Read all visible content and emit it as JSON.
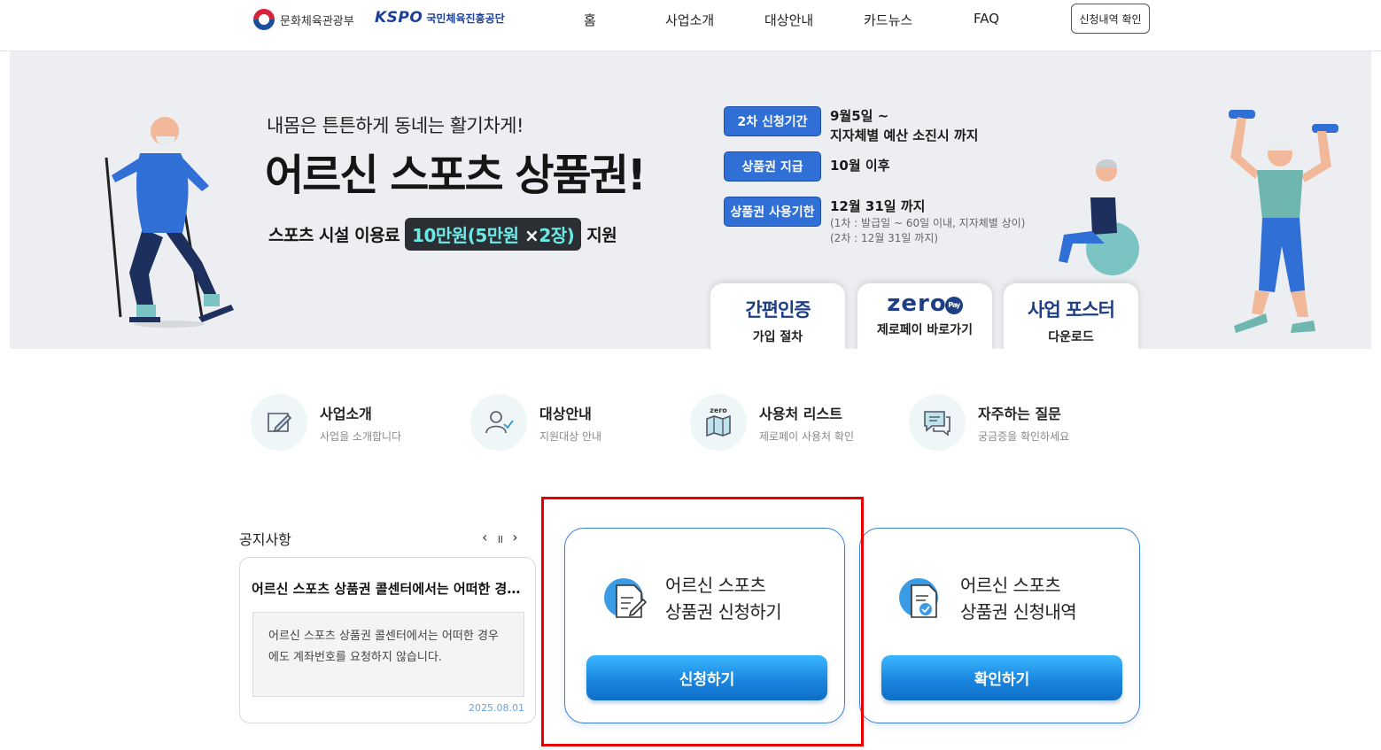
{
  "header": {
    "gov_logo_text": "문화체육관광부",
    "kspo_logo_en": "KSPO",
    "kspo_logo_ko": "국민체육진흥공단",
    "nav": [
      "홈",
      "사업소개",
      "대상안내",
      "카드뉴스",
      "FAQ"
    ],
    "check_button": "신청내역 확인"
  },
  "hero": {
    "subtitle": "내몸은 튼튼하게 동네는 활기차게!",
    "title": "어르신 스포츠 상품권!",
    "support_prefix": "스포츠 시설 이용료",
    "support_badge_a": "10만원(5만원",
    "support_badge_x": "×",
    "support_badge_b": "2장)",
    "support_suffix": "지원",
    "info": [
      {
        "tag": "2차 신청기간",
        "line1": "9월5일 ~",
        "line2": "지자체별 예산 소진시 까지"
      },
      {
        "tag": "상품권 지급",
        "line1": "10월 이후"
      },
      {
        "tag": "상품권 사용기한",
        "line1": "12월 31일 까지",
        "note1": "(1차 : 발급일 ~ 60일 이내, 지자체별 상이)",
        "note2": "(2차 : 12월 31일 까지)"
      }
    ],
    "tabs": [
      {
        "title": "간편인증",
        "label": "가입 절차"
      },
      {
        "title": "zero",
        "badge": "Pay",
        "label": "제로페이 바로가기"
      },
      {
        "title": "사업 포스터",
        "label": "다운로드"
      }
    ]
  },
  "quick_menu": [
    {
      "title": "사업소개",
      "desc": "사업을 소개합니다",
      "icon": "pen-paper-icon"
    },
    {
      "title": "대상안내",
      "desc": "지원대상 안내",
      "icon": "user-check-icon"
    },
    {
      "title": "사용처 리스트",
      "desc": "제로페이 사용처 확인",
      "icon": "map-icon",
      "icon_label": "zero"
    },
    {
      "title": "자주하는 질문",
      "desc": "궁금증을 확인하세요",
      "icon": "chat-icon"
    }
  ],
  "notice": {
    "heading": "공지사항",
    "prev": "‹",
    "pause": "॥",
    "next": "›",
    "title": "어르신 스포츠 상품권 콜센터에서는 어떠한 경우에도 계좌번호를 요청하지 않습니다.",
    "body": "어르신 스포츠 상품권 콜센터에서는 어떠한 경우에도 계좌번호를 요청하지 않습니다.",
    "date": "2025.08.01"
  },
  "actions": [
    {
      "line1": "어르신 스포츠",
      "line2": "상품권 신청하기",
      "button": "신청하기",
      "icon": "apply-document-icon"
    },
    {
      "line1": "어르신 스포츠",
      "line2": "상품권 신청내역",
      "button": "확인하기",
      "icon": "history-document-icon"
    }
  ],
  "colors": {
    "accent": "#2f6fd6",
    "button_gradient_top": "#3ab6ff",
    "button_gradient_bottom": "#0e6fc6",
    "highlight": "#e80000"
  }
}
